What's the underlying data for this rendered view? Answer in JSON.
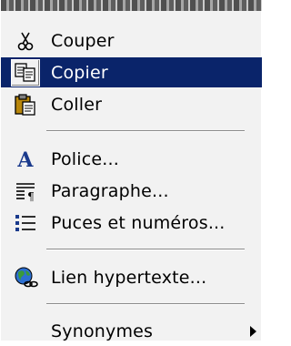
{
  "menu": {
    "items": [
      {
        "label": "Couper",
        "icon": "scissors-icon"
      },
      {
        "label": "Copier",
        "icon": "copy-icon",
        "selected": true
      },
      {
        "label": "Coller",
        "icon": "paste-icon"
      },
      {
        "label": "Police...",
        "icon": "font-icon"
      },
      {
        "label": "Paragraphe...",
        "icon": "paragraph-icon"
      },
      {
        "label": "Puces et numéros...",
        "icon": "bullets-icon"
      },
      {
        "label": "Lien hypertexte...",
        "icon": "hyperlink-globe-icon"
      },
      {
        "label": "Synonymes",
        "has_submenu": true
      }
    ]
  },
  "colors": {
    "menu_bg": "#f2f2f2",
    "selection_bg": "#0a246a",
    "selection_text": "#ffffff"
  }
}
